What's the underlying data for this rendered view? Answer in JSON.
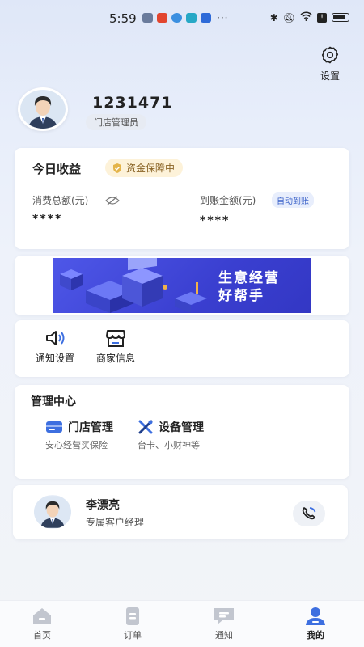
{
  "status_bar": {
    "time": "5:59",
    "more": "···"
  },
  "header": {
    "settings_label": "设置"
  },
  "profile": {
    "user_id": "1231471",
    "role": "门店管理员"
  },
  "income": {
    "title": "今日收益",
    "guarantee": "资金保障中",
    "total_label": "消费总额(元)",
    "total_value": "****",
    "received_label": "到账金额(元)",
    "received_value": "****",
    "auto_badge": "自动到账"
  },
  "banner": {
    "line1": "生意经营",
    "line2": "好帮手"
  },
  "quick_actions": [
    {
      "label": "通知设置",
      "icon": "speaker-icon"
    },
    {
      "label": "商家信息",
      "icon": "store-icon"
    }
  ],
  "management": {
    "title": "管理中心",
    "items": [
      {
        "title": "门店管理",
        "subtitle": "安心经营买保险",
        "icon": "store-card-icon"
      },
      {
        "title": "设备管理",
        "subtitle": "台卡、小财神等",
        "icon": "tools-icon"
      }
    ]
  },
  "account_manager": {
    "name": "李漂亮",
    "title": "专属客户经理"
  },
  "tabbar": {
    "tabs": [
      {
        "label": "首页",
        "icon": "home-icon",
        "active": false
      },
      {
        "label": "订单",
        "icon": "order-icon",
        "active": false
      },
      {
        "label": "通知",
        "icon": "message-icon",
        "active": false
      },
      {
        "label": "我的",
        "icon": "user-icon",
        "active": true
      }
    ]
  },
  "colors": {
    "accent": "#3c63c9",
    "active_tab": "#3d6fe0",
    "guarantee_bg": "#fdf2d9",
    "banner": "#3a3fd0"
  }
}
